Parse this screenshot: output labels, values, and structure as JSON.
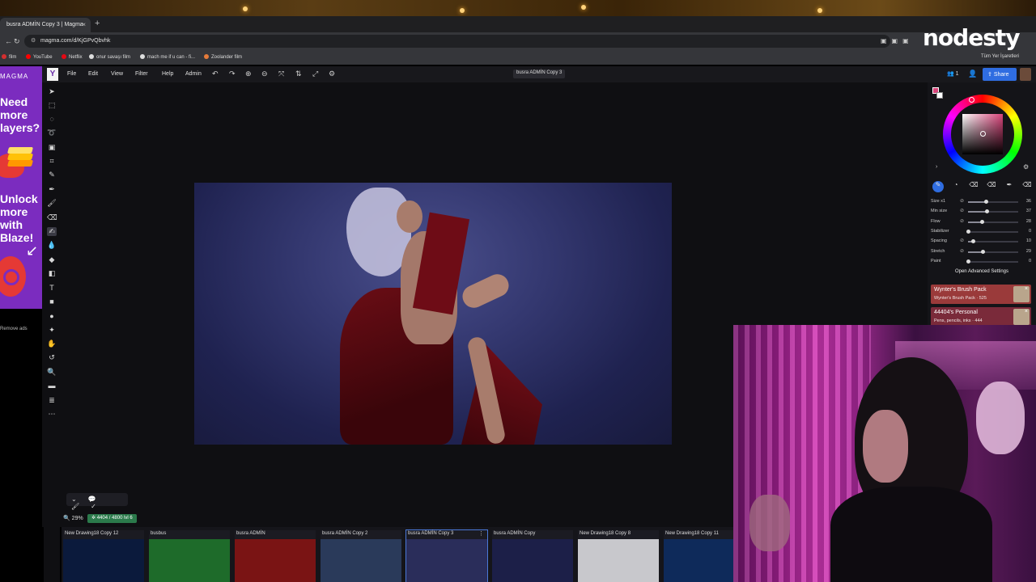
{
  "browser": {
    "tab_title": "busra ADMİN Copy 3 | Magma",
    "new_tab": "+",
    "url": "magma.com/d/KjGPvQbvhk",
    "bookmarks": [
      "film",
      "YouTube",
      "Netflix",
      "onur savaşı film",
      "mach me if u can - fi...",
      "Zoolander film"
    ],
    "bookmarks_right": "Tüm Yer İşaretleri"
  },
  "overlay_logo": "nodesty",
  "ad": {
    "brand": "MAGMA",
    "lines": [
      "Need",
      "more",
      "layers?"
    ],
    "lines2": [
      "Unlock",
      "more",
      "with",
      "Blaze!"
    ],
    "remove_ads": "Remove ads"
  },
  "app": {
    "menu": [
      "File",
      "Edit",
      "View",
      "Filter",
      "Help",
      "Admin"
    ],
    "doc_title": "busra ADMİN Copy 3",
    "users_count": "1",
    "share_label": "Share",
    "avatar_tooltip": "7b3c4f"
  },
  "status": {
    "zoom": "29%",
    "pixels": "4404 / 4800",
    "level": "lvl 6"
  },
  "thumbnails": [
    {
      "label": "New Drawing18 Copy 12",
      "color": "#0b1a3c"
    },
    {
      "label": "busbus",
      "color": "#1e6b2a"
    },
    {
      "label": "busra ADMİN",
      "color": "#7a1414"
    },
    {
      "label": "busra ADMİN Copy 2",
      "color": "#2a3a5a"
    },
    {
      "label": "busra ADMİN Copy 3",
      "color": "#2a2d5a"
    },
    {
      "label": "busra ADMİN Copy",
      "color": "#1c1f48"
    },
    {
      "label": "New Drawing18 Copy 8",
      "color": "#c8c8cc"
    },
    {
      "label": "New Drawing18 Copy 11",
      "color": "#0e2a5a"
    }
  ],
  "brush": {
    "sliders": [
      {
        "name": "Size x1",
        "value": "36",
        "fraction": 0.36
      },
      {
        "name": "Min size",
        "value": "37",
        "fraction": 0.37
      },
      {
        "name": "Flow",
        "value": "28",
        "fraction": 0.28
      },
      {
        "name": "Stabilizer",
        "value": "0",
        "fraction": 0.0
      },
      {
        "name": "Spacing",
        "value": "10",
        "fraction": 0.1
      },
      {
        "name": "Stretch",
        "value": "29",
        "fraction": 0.29
      },
      {
        "name": "Paint",
        "value": "0",
        "fraction": 0.0
      }
    ],
    "advanced_label": "Open Advanced Settings",
    "packs": [
      {
        "title": "Wynter's Brush Pack",
        "subtitle": "Wynter's Brush Pack · 525",
        "color": "#9a3a3a"
      },
      {
        "title": "44404's Personal",
        "subtitle": "Pens, pencils, inks · 444",
        "color": "#7a2a3a"
      }
    ]
  },
  "colors": {
    "accent": "#2f6de1",
    "primary_swatch": "#d8447a"
  }
}
